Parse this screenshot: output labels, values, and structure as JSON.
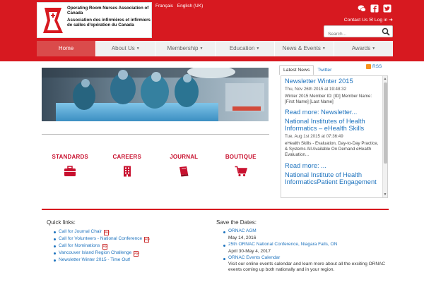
{
  "header": {
    "org_name_en": "Operating Room Nurses Association of Canada",
    "org_name_fr": "Association des infirmières et infirmiers de salles d'opération du Canada",
    "lang_fr": "Français",
    "lang_en": "English (UK)",
    "contact_label": "Contact Us",
    "login_label": "Log in",
    "search_placeholder": "Search..."
  },
  "nav": [
    {
      "label": "Home",
      "active": true,
      "dropdown": false
    },
    {
      "label": "About Us",
      "active": false,
      "dropdown": true
    },
    {
      "label": "Membership",
      "active": false,
      "dropdown": true
    },
    {
      "label": "Education",
      "active": false,
      "dropdown": true
    },
    {
      "label": "News & Events",
      "active": false,
      "dropdown": true
    },
    {
      "label": "Awards",
      "active": false,
      "dropdown": true
    }
  ],
  "tiles": [
    {
      "label": "STANDARDS",
      "icon": "briefcase-icon"
    },
    {
      "label": "CAREERS",
      "icon": "building-icon"
    },
    {
      "label": "JOURNAL",
      "icon": "book-icon"
    },
    {
      "label": "BOUTIQUE",
      "icon": "cart-icon"
    }
  ],
  "news_tabs": {
    "latest": "Latest News",
    "twitter": "Twitter",
    "rss": "RSS"
  },
  "news_items": [
    {
      "title": "Newsletter Winter 2015",
      "date": "Thu, Nov 26th 2015 at 19:48:32",
      "body": "Winter 2015 Member ID: [ID] Member Name: [First Name] [Last Name]",
      "more": "Read more: Newsletter..."
    },
    {
      "title": "National Institutes of Health Informatics – eHealth Skills",
      "date": "Tue, Aug 1st 2015 at 07:36:49",
      "body": "eHealth Skills - Evaluation, Day-to-Day Practice, & Systems All Available On Demand eHealth Evaluation...",
      "more": "Read more: ..."
    },
    {
      "title": "National Institute of Health InformaticsPatient Engagement"
    }
  ],
  "quick_links": {
    "title": "Quick links:",
    "items": [
      "Call for Journal Chair",
      "Call for Volunteers - National Conference",
      "Call for Nominations",
      "Vancouver Island Region Challenge",
      "Newsletter Winter 2015 - Time Out!"
    ]
  },
  "save_dates": {
    "title": "Save the Dates:",
    "items": [
      {
        "event": "ORNAC AGM",
        "date": "May 14, 2016"
      },
      {
        "event": "25th ORNAC National Conference, Niagara Falls, ON",
        "date": "April 30-May 4, 2017"
      },
      {
        "event": "ORNAC Events Calendar",
        "date": "Visit our online events calendar and learn more about all the exciting ORNAC events coming up both nationally and in your region."
      }
    ]
  },
  "colors": {
    "brand_red": "#d71920",
    "link_blue": "#1e73be",
    "nav_active": "#da4b4b"
  }
}
